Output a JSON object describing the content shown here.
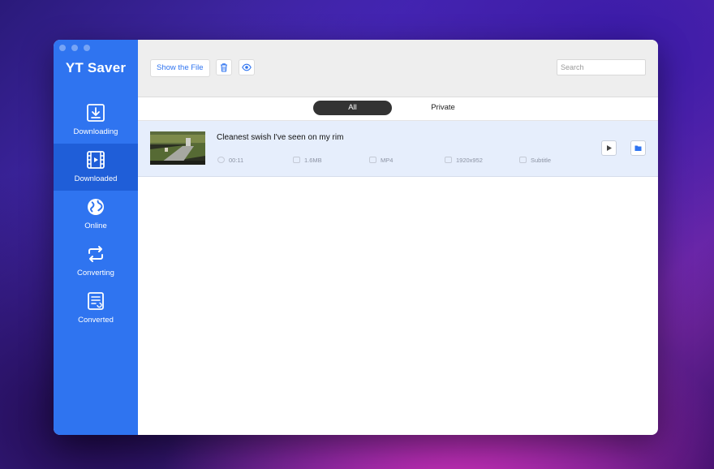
{
  "app": {
    "name": "YT Saver"
  },
  "sidebar": {
    "items": [
      {
        "label": "Downloading",
        "icon": "download-icon",
        "active": false
      },
      {
        "label": "Downloaded",
        "icon": "film-icon",
        "active": true
      },
      {
        "label": "Online",
        "icon": "globe-icon",
        "active": false
      },
      {
        "label": "Converting",
        "icon": "convert-icon",
        "active": false
      },
      {
        "label": "Converted",
        "icon": "converted-doc-icon",
        "active": false
      }
    ]
  },
  "toolbar": {
    "show_file_label": "Show the File",
    "delete_icon": "trash-icon",
    "preview_icon": "eye-icon",
    "search_placeholder": "Search"
  },
  "tabs": {
    "all": "All",
    "private": "Private",
    "active": "All"
  },
  "files": [
    {
      "title": "Cleanest swish I've seen on my rim",
      "duration": "00:11",
      "size": "1.6MB",
      "format": "MP4",
      "resolution": "1920x952",
      "subtitle": "Subtitle"
    }
  ],
  "colors": {
    "sidebar": "#2f74f0",
    "sidebar_active": "#1f5ed8",
    "accent": "#2f74f0",
    "row_selected": "#e6eefc"
  }
}
